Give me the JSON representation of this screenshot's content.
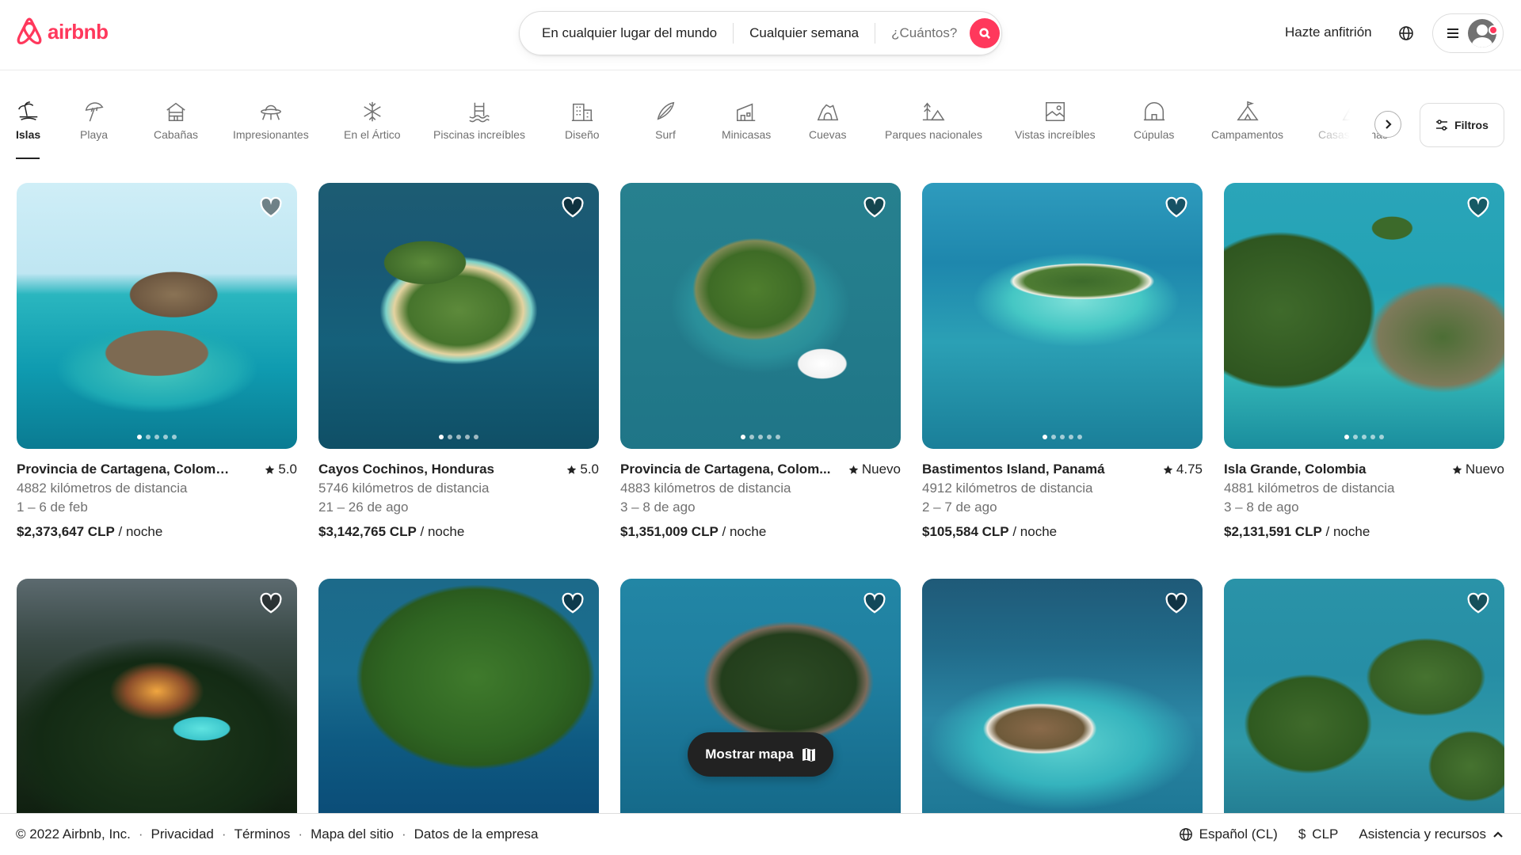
{
  "header": {
    "logo_text": "airbnb",
    "search": {
      "location": "En cualquier lugar del mundo",
      "week": "Cualquier semana",
      "guests": "¿Cuántos?"
    },
    "host_link": "Hazte anfitrión"
  },
  "categories": [
    {
      "label": "Islas",
      "icon": "island-icon"
    },
    {
      "label": "Playa",
      "icon": "beach-umbrella-icon"
    },
    {
      "label": "Cabañas",
      "icon": "cabin-icon"
    },
    {
      "label": "Impresionantes",
      "icon": "ufo-icon"
    },
    {
      "label": "En el Ártico",
      "icon": "snowflake-icon"
    },
    {
      "label": "Piscinas increíbles",
      "icon": "pool-icon"
    },
    {
      "label": "Diseño",
      "icon": "design-building-icon"
    },
    {
      "label": "Surf",
      "icon": "surfboard-icon"
    },
    {
      "label": "Minicasas",
      "icon": "tiny-house-icon"
    },
    {
      "label": "Cuevas",
      "icon": "cave-icon"
    },
    {
      "label": "Parques nacionales",
      "icon": "park-icon"
    },
    {
      "label": "Vistas increíbles",
      "icon": "view-icon"
    },
    {
      "label": "Cúpulas",
      "icon": "dome-icon"
    },
    {
      "label": "Campamentos",
      "icon": "campsite-icon"
    },
    {
      "label": "Casas alpinas",
      "icon": "a-frame-icon"
    }
  ],
  "filters_label": "Filtros",
  "listings": [
    {
      "title": "Provincia de Cartagena, Colombia",
      "rating": "5.0",
      "distance": "4882 kilómetros de distancia",
      "dates": "1 – 6 de feb",
      "price": "$2,373,647 CLP",
      "per": " / noche"
    },
    {
      "title": "Cayos Cochinos, Honduras",
      "rating": "5.0",
      "distance": "5746 kilómetros de distancia",
      "dates": "21 – 26 de ago",
      "price": "$3,142,765 CLP",
      "per": " / noche"
    },
    {
      "title": "Provincia de Cartagena, Colom...",
      "rating": "Nuevo",
      "distance": "4883 kilómetros de distancia",
      "dates": "3 – 8 de ago",
      "price": "$1,351,009 CLP",
      "per": " / noche"
    },
    {
      "title": "Bastimentos Island, Panamá",
      "rating": "4.75",
      "distance": "4912 kilómetros de distancia",
      "dates": "2 – 7 de ago",
      "price": "$105,584 CLP",
      "per": " / noche"
    },
    {
      "title": "Isla Grande, Colombia",
      "rating": "Nuevo",
      "distance": "4881 kilómetros de distancia",
      "dates": "3 – 8 de ago",
      "price": "$2,131,591 CLP",
      "per": " / noche"
    }
  ],
  "map_button": "Mostrar mapa",
  "footer": {
    "copyright": "© 2022 Airbnb, Inc.",
    "links": [
      "Privacidad",
      "Términos",
      "Mapa del sitio",
      "Datos de la empresa"
    ],
    "language": "Español (CL)",
    "currency_symbol": "$",
    "currency": "CLP",
    "support": "Asistencia y recursos"
  },
  "colors": {
    "brand": "#ff385c",
    "text": "#222222",
    "muted": "#717171"
  }
}
